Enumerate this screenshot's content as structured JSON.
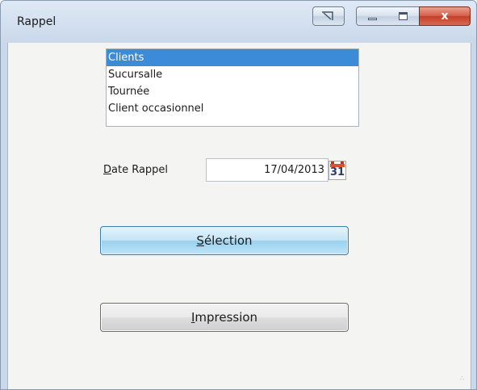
{
  "window": {
    "title": "Rappel",
    "close_label": "x"
  },
  "list": {
    "items": [
      {
        "label": "Clients",
        "selected": true
      },
      {
        "label": "Sucursalle",
        "selected": false
      },
      {
        "label": "Tournée",
        "selected": false
      },
      {
        "label": "Client occasionnel",
        "selected": false
      }
    ]
  },
  "date": {
    "label": "Date Rappel",
    "label_mnemonic": "D",
    "label_rest": "ate Rappel",
    "value": "17/04/2013",
    "calendar_icon": "calendar-icon",
    "calendar_day": "31"
  },
  "buttons": {
    "selection": {
      "label": "Sélection",
      "mnemonic": "S",
      "rest": "élection"
    },
    "impression": {
      "label": "Impression",
      "mnemonic": "I",
      "rest": "mpression"
    }
  },
  "colors": {
    "selection_highlight": "#3c8bd8",
    "close_button": "#c43f27"
  }
}
